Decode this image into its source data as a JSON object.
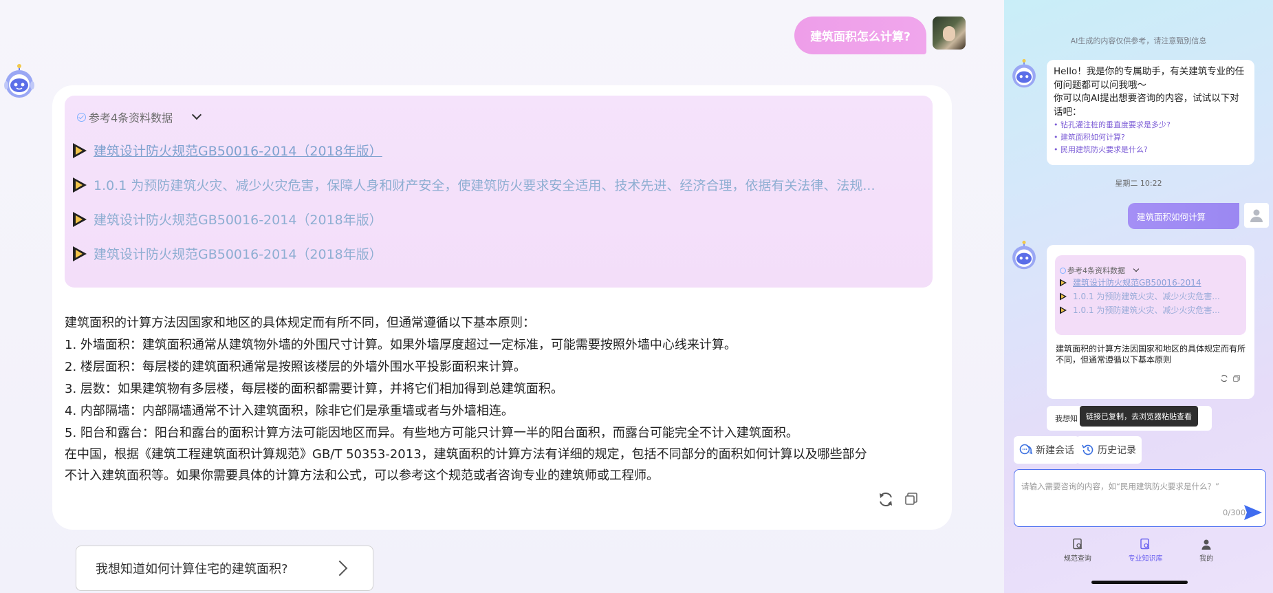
{
  "main": {
    "user_question": "建筑面积怎么计算?",
    "refs": {
      "header": "参考4条资料数据",
      "items": [
        "建筑设计防火规范GB50016-2014（2018年版）",
        "1.0.1 为预防建筑火灾、减少火灾危害，保障人身和财产安全，使建筑防火要求安全适用、技术先进、经济合理，依据有关法律、法规...",
        "建筑设计防火规范GB50016-2014（2018年版）",
        "建筑设计防火规范GB50016-2014（2018年版）"
      ]
    },
    "answer": [
      "建筑面积的计算方法因国家和地区的具体规定而有所不同，但通常遵循以下基本原则：",
      "1. 外墙面积：建筑面积通常从建筑物外墙的外围尺寸计算。如果外墙厚度超过一定标准，可能需要按照外墙中心线来计算。",
      "2. 楼层面积：每层楼的建筑面积通常是按照该楼层的外墙外围水平投影面积来计算。",
      "3. 层数：如果建筑物有多层楼，每层楼的面积都需要计算，并将它们相加得到总建筑面积。",
      "4. 内部隔墙：内部隔墙通常不计入建筑面积，除非它们是承重墙或者与外墙相连。",
      "5. 阳台和露台：阳台和露台的面积计算方法可能因地区而异。有些地方可能只计算一半的阳台面积，而露台可能完全不计入建筑面积。",
      "在中国，根据《建筑工程建筑面积计算规范》GB/T 50353-2013，建筑面积的计算方法有详细的规定，包括不同部分的面积如何计算以及哪些部分",
      "不计入建筑面积等。如果你需要具体的计算方法和公式，可以参考这个规范或者咨询专业的建筑师或工程师。"
    ],
    "suggestion": "我想知道如何计算住宅的建筑面积?"
  },
  "phone": {
    "disclaimer": "AI生成的内容仅供参考，请注意甄别信息",
    "welcome": {
      "line1": "Hello！我是你的专属助手，有关建筑专业的任何问题都可以问我哦～",
      "line2": "你可以向AI提出想要咨询的内容，试试以下对话吧：",
      "questions": [
        "钻孔灌注桩的垂直度要求是多少?",
        "建筑面积如何计算?",
        "民用建筑防火要求是什么?"
      ]
    },
    "timestamp": "星期二 10:22",
    "user_message": "建筑面积如何计算",
    "refs": {
      "header": "参考4条资料数据",
      "items": [
        "建筑设计防火规范GB50016-2014",
        "1.0.1 为预防建筑火灾、减少火灾危害...",
        "1.0.1 为预防建筑火灾、减少火灾危害..."
      ]
    },
    "answer": "建筑面积的计算方法因国家和地区的具体规定而有所不同，但通常遵循以下基本原则",
    "suggestion_partial": "我想知",
    "toast": "链接已复制，去浏览器粘贴查看",
    "new_chat": "新建会话",
    "history": "历史记录",
    "input_placeholder": "请输入需要咨询的内容，如“民用建筑防火要求是什么？”",
    "counter": "0/300",
    "tabs": [
      "规范查询",
      "专业知识库",
      "我的"
    ],
    "active_tab": 1
  },
  "colors": {
    "user_bubble": "#ee9ee9",
    "ref_bg": "#f5e3fb",
    "accent": "#4d6ff0",
    "phone_user_bubble": "#a48ff5"
  }
}
